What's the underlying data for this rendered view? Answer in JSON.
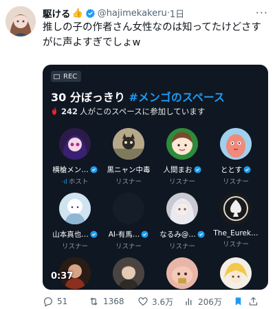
{
  "tweet": {
    "author_name": "駆ける",
    "author_emoji": "👍",
    "handle": "@hajimekakeru",
    "separator": "·",
    "time": "1日",
    "more": "···",
    "text": "推しの子の作者さん女性なのは知ってたけどさすがに声よすぎでしょw"
  },
  "space": {
    "rec_label": "REC",
    "title_prefix": "30 分ぼっきり",
    "title_tag": "#メンゴのスペース",
    "listener_count": "242",
    "listener_text": "人がこのスペースに参加しています",
    "timestamp": "0:37",
    "participants": [
      {
        "name": "横槍メン…",
        "role": "ホスト",
        "verified": true,
        "host": true
      },
      {
        "name": "黒ニャン中毒",
        "role": "リスナー",
        "verified": false
      },
      {
        "name": "人間まお",
        "role": "リスナー",
        "verified": true
      },
      {
        "name": "ととす",
        "role": "リスナー",
        "verified": true
      },
      {
        "name": "山本真也…",
        "role": "リスナー",
        "verified": true
      },
      {
        "name": "AI-有馬…",
        "role": "リスナー",
        "verified": true
      },
      {
        "name": "なるみ@…",
        "role": "リスナー",
        "verified": true
      },
      {
        "name": "The_Eurek…",
        "role": "リスナー",
        "verified": false
      },
      {
        "name": "",
        "role": "",
        "verified": false
      },
      {
        "name": "",
        "role": "",
        "verified": false
      },
      {
        "name": "",
        "role": "",
        "verified": false
      },
      {
        "name": "",
        "role": "",
        "verified": false
      }
    ]
  },
  "actions": {
    "replies": "51",
    "retweets": "1368",
    "likes": "3.6万",
    "views": "206万"
  },
  "colors": {
    "verified_blue": "#1d9bf0",
    "card_bg": "#0f1722",
    "secondary_text": "#536471"
  }
}
